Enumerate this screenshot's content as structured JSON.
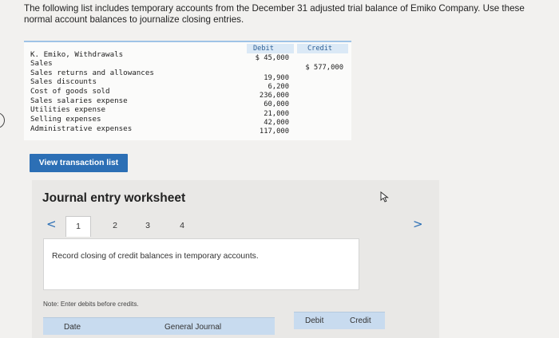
{
  "instructions": {
    "line1": "The following list includes temporary accounts from the December 31 adjusted trial balance of Emiko Company. Use these",
    "line2": "normal account balances to journalize closing entries."
  },
  "trial_balance": {
    "debit_header": "Debit",
    "credit_header": "Credit",
    "accounts": [
      {
        "name": "K. Emiko, Withdrawals",
        "debit": "$ 45,000",
        "credit": ""
      },
      {
        "name": "Sales",
        "debit": "",
        "credit": "$ 577,000"
      },
      {
        "name": "Sales returns and allowances",
        "debit": "19,900",
        "credit": ""
      },
      {
        "name": "Sales discounts",
        "debit": "6,200",
        "credit": ""
      },
      {
        "name": "Cost of goods sold",
        "debit": "236,000",
        "credit": ""
      },
      {
        "name": "Sales salaries expense",
        "debit": "60,000",
        "credit": ""
      },
      {
        "name": "Utilities expense",
        "debit": "21,000",
        "credit": ""
      },
      {
        "name": "Selling expenses",
        "debit": "42,000",
        "credit": ""
      },
      {
        "name": "Administrative expenses",
        "debit": "117,000",
        "credit": ""
      }
    ]
  },
  "view_button": {
    "label": "View transaction list"
  },
  "worksheet": {
    "title": "Journal entry worksheet",
    "tabs": [
      "1",
      "2",
      "3",
      "4"
    ],
    "active_tab": "1",
    "instruction": "Record closing of credit balances in temporary accounts.",
    "note": "Note: Enter debits before credits.",
    "columns": {
      "date": "Date",
      "general_journal": "General Journal",
      "debit": "Debit",
      "credit": "Credit"
    }
  },
  "icons": {
    "prev": "chevron-left-icon",
    "next": "chevron-right-icon",
    "cursor": "mouse-pointer-icon"
  },
  "colors": {
    "accent": "#2c6fb5",
    "header_bg": "#c8dbef",
    "table_header_bg": "#dbe9f6"
  }
}
